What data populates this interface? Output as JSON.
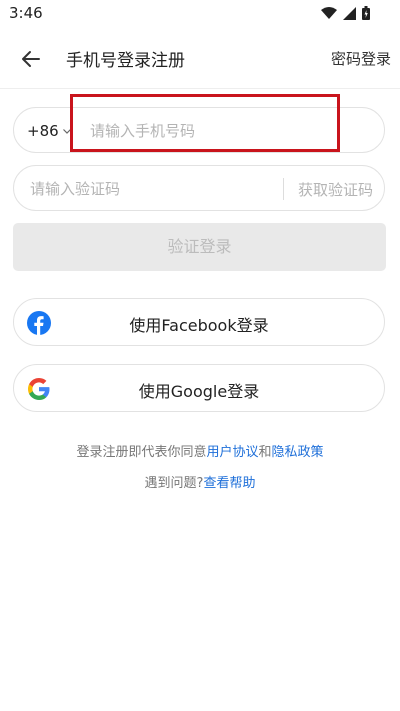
{
  "status_bar": {
    "time": "3:46",
    "icons": [
      "wifi-icon",
      "signal-icon",
      "battery-icon"
    ]
  },
  "header": {
    "title": "手机号登录注册",
    "password_login": "密码登录",
    "back_icon": "back-arrow-icon"
  },
  "phone": {
    "country_code": "+86",
    "placeholder": "请输入手机号码"
  },
  "code": {
    "placeholder": "请输入验证码",
    "get_code": "获取验证码"
  },
  "verify_button": "验证登录",
  "social": {
    "facebook": "使用Facebook登录",
    "google": "使用Google登录"
  },
  "agreement": {
    "prefix": "登录注册即代表你同意",
    "user_agreement": "用户协议",
    "and": "和",
    "privacy_policy": "隐私政策"
  },
  "help": {
    "prefix": "遇到问题?",
    "link": "查看帮助"
  },
  "colors": {
    "link": "#1e6fd9",
    "highlight": "#c9141c",
    "facebook": "#1877f2"
  }
}
